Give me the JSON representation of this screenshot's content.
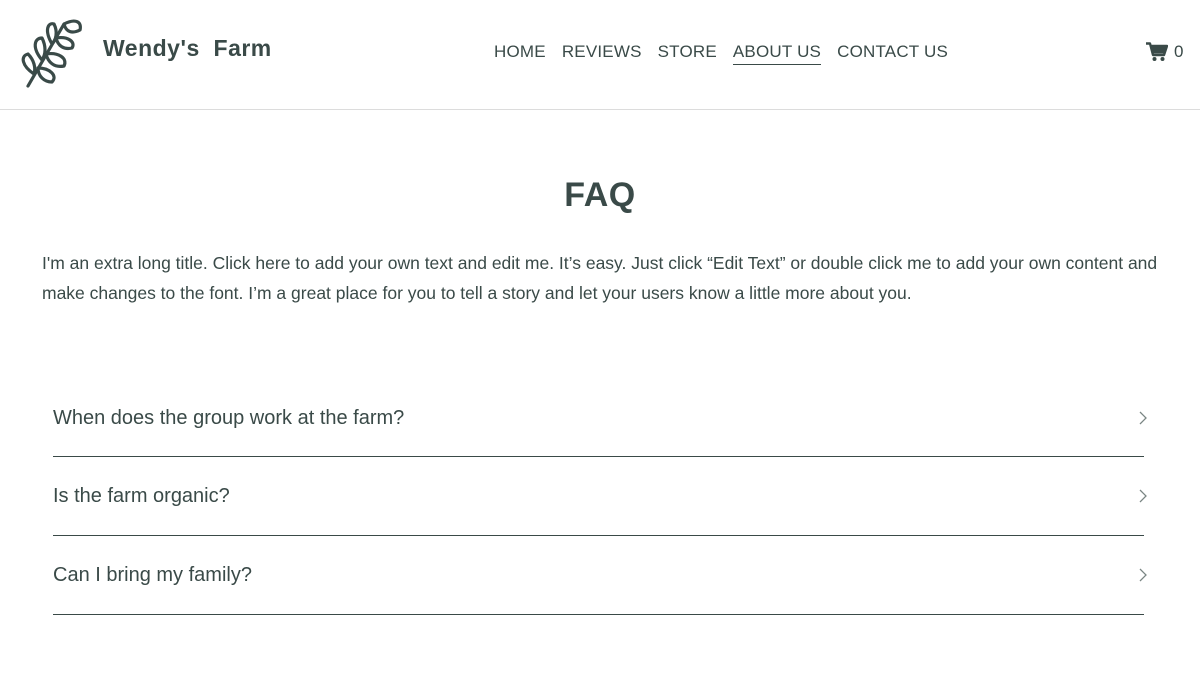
{
  "brand": {
    "name": "Wendy's  Farm",
    "logo_icon": "leaf-branch-icon"
  },
  "nav": {
    "items": [
      {
        "label": "HOME",
        "active": false
      },
      {
        "label": "REVIEWS",
        "active": false
      },
      {
        "label": "STORE",
        "active": false
      },
      {
        "label": "ABOUT US",
        "active": true
      },
      {
        "label": "CONTACT US",
        "active": false
      }
    ]
  },
  "cart": {
    "icon": "shopping-cart-icon",
    "count": "0"
  },
  "faq": {
    "title": "FAQ",
    "intro": "I'm an extra long title. Click here to add your own text and edit me. It’s easy. Just click “Edit Text” or double click me to add your own content and make changes to the font. I’m a great place for you to tell a story and let your users know a little more about you.",
    "questions": [
      {
        "question": "When does the group work at the farm?",
        "expanded": false
      },
      {
        "question": "Is the farm organic?",
        "expanded": false
      },
      {
        "question": "Can I bring my family?",
        "expanded": false
      }
    ]
  },
  "colors": {
    "text": "#3a4a48",
    "background": "#ffffff",
    "divider": "#dcdcdc"
  }
}
